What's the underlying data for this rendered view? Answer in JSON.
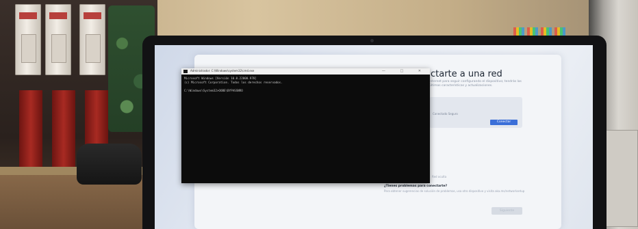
{
  "oobe": {
    "title": "ctarte a una red",
    "description": "Internet para seguir configurando el dispositivo; tendrás las últimas características y actualizaciones.",
    "network_label": "Conectado Seguro",
    "connect_label": "Conectar",
    "hidden_network": "Red oculta",
    "problems_title": "¿Tienes problemas para conectarte?",
    "problems_description": "Para obtener sugerencias de solución de problemas, usa otro dispositivo y visita aka.ms/networksetup",
    "next_label": "Siguiente"
  },
  "cmd": {
    "title": "Administrador: C:\\Windows\\system32\\cmd.exe",
    "controls": "— □ ✕",
    "lines": [
      "Microsoft Windows [Versión 10.0.22000.978]",
      "(c) Microsoft Corporation. Todos los derechos reservados.",
      "",
      "C:\\Windows\\System32>OOBE\\BYPASSNRO"
    ]
  },
  "colors": {
    "accent_button": "#3b6fd8",
    "terminal_bg": "#0c0c0c",
    "screen_bg": "#e7ecf4"
  }
}
